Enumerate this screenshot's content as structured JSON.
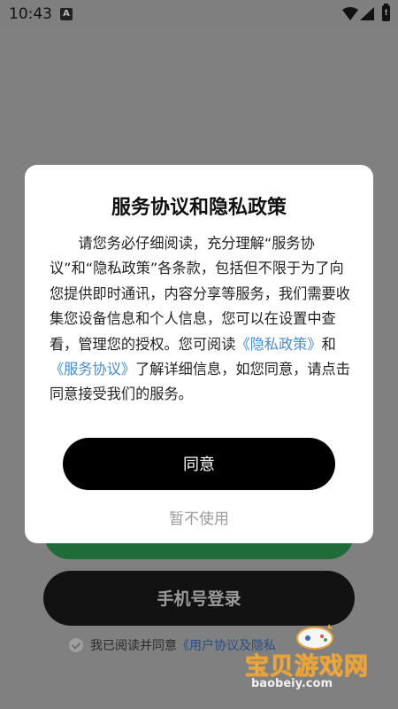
{
  "status_bar": {
    "time": "10:43",
    "notification_badge": "A",
    "battery_mark": "!"
  },
  "background": {
    "phone_login_label": "手机号登录",
    "agreement_prefix": "我已阅读并同意",
    "agreement_link": "《用户协议及隐私"
  },
  "watermark": {
    "text": "宝贝游戏网",
    "url": "baobeiy.com"
  },
  "dialog": {
    "title": "服务协议和隐私政策",
    "body_part1": "请您务必仔细阅读，充分理解“服务协议”和“隐私政策”各条款，包括但不限于为了向您提供即时通讯，内容分享等服务，我们需要收集您设备信息和个人信息，您可以在设置中查看，管理您的授权。您可阅读",
    "privacy_link": "《隐私政策》",
    "body_and": "和",
    "service_link": "《服务协议》",
    "body_part2": "了解详细信息，如您同意，请点击同意接受我们的服务。",
    "agree_label": "同意",
    "reject_label": "暂不使用"
  },
  "colors": {
    "overlay": "#808080",
    "link": "#4a8ad0",
    "green_button": "#1f6b3a"
  }
}
